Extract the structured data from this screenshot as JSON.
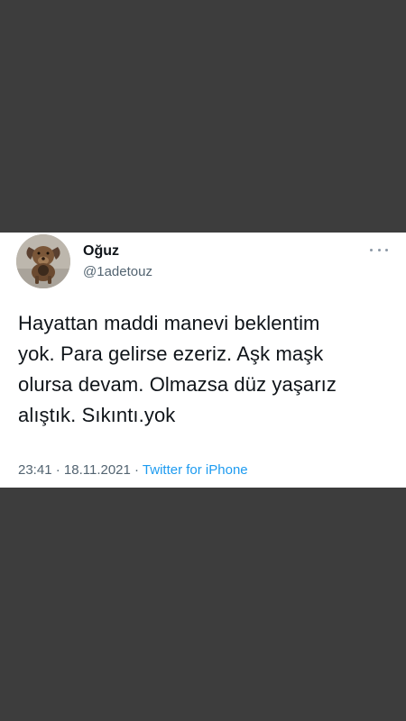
{
  "tweet": {
    "author": {
      "display_name": "Oğuz",
      "handle": "@1adetouz"
    },
    "text_lines": [
      "Hayattan maddi manevi beklentim",
      "yok. Para gelirse ezeriz. Aşk maşk",
      "olursa devam. Olmazsa düz yaşarız",
      "alıştık. Sıkıntı.yok"
    ],
    "time": "23:41",
    "separator": " · ",
    "date": "18.11.2021",
    "source": "Twitter for iPhone"
  },
  "colors": {
    "background": "#3d3d3d",
    "card": "#ffffff",
    "text_primary": "#0f1419",
    "text_secondary": "#536471",
    "link": "#1d9bf0"
  },
  "icons": {
    "more": "more-horizontal-icon"
  }
}
